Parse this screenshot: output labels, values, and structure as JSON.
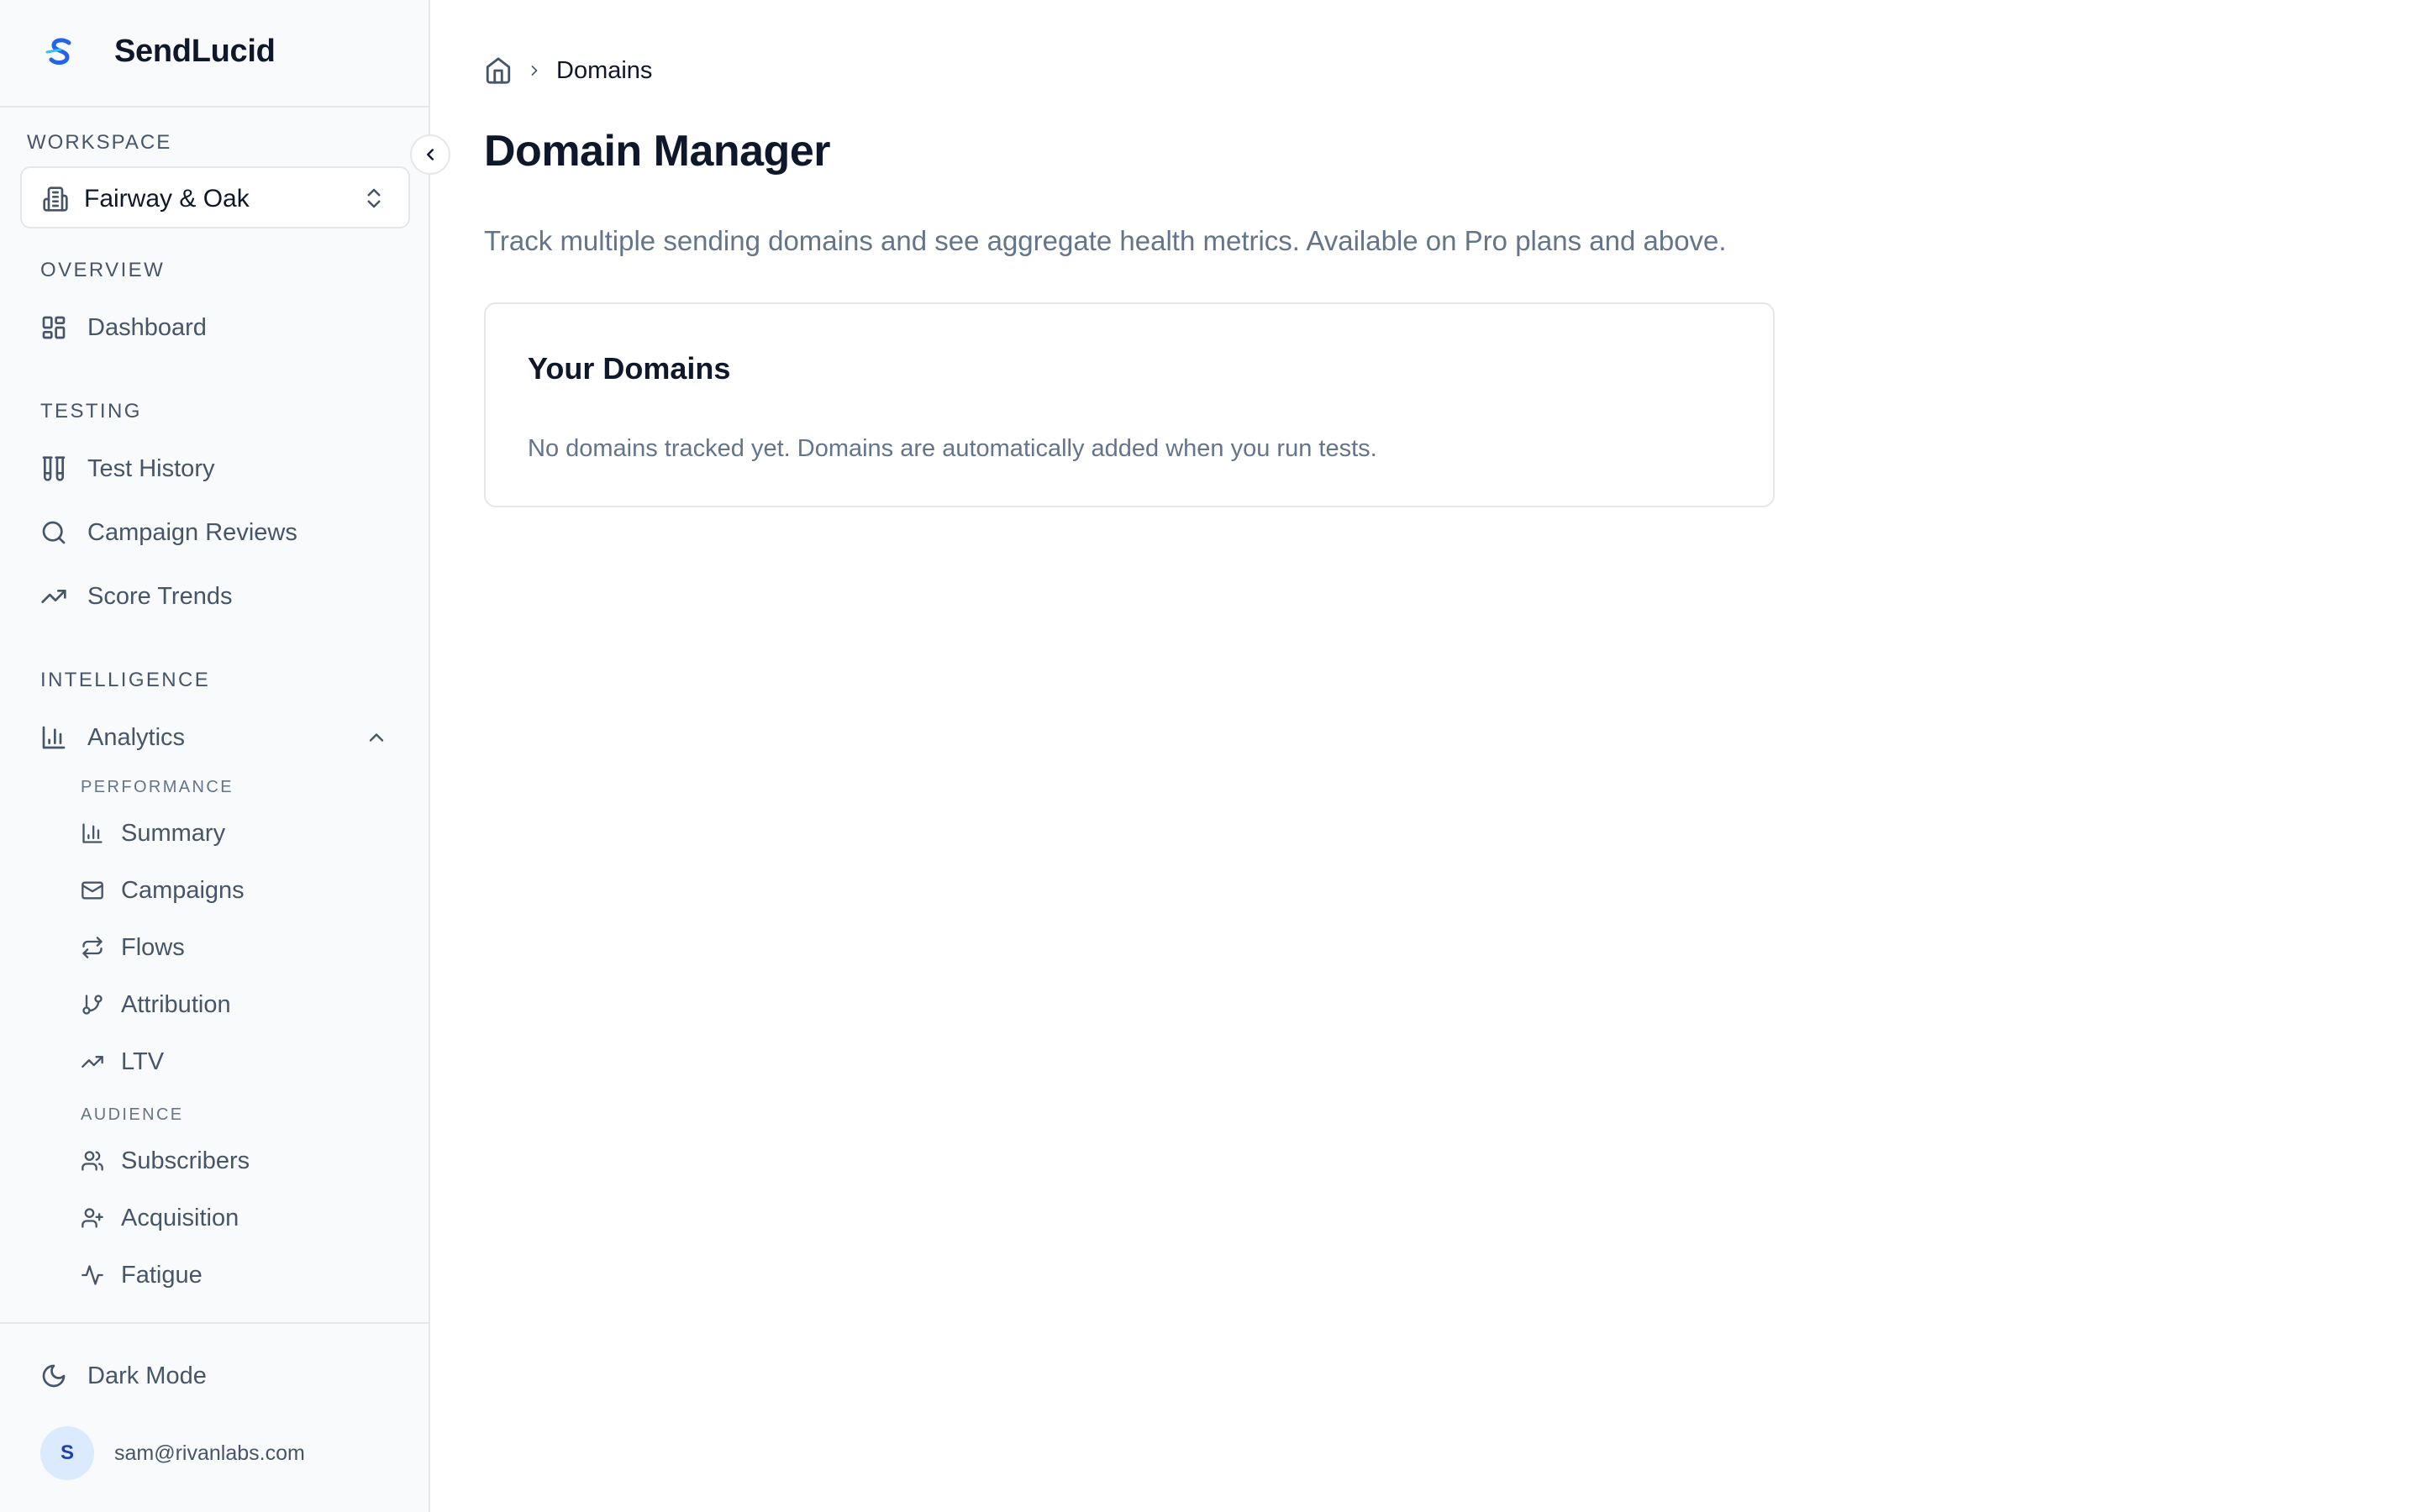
{
  "brand": {
    "name": "SendLucid"
  },
  "workspace": {
    "label": "WORKSPACE",
    "selected": "Fairway & Oak"
  },
  "nav": {
    "overview": {
      "label": "OVERVIEW",
      "items": [
        {
          "label": "Dashboard",
          "icon": "dashboard-icon"
        }
      ]
    },
    "testing": {
      "label": "TESTING",
      "items": [
        {
          "label": "Test History",
          "icon": "test-tubes-icon"
        },
        {
          "label": "Campaign Reviews",
          "icon": "search-icon"
        },
        {
          "label": "Score Trends",
          "icon": "trending-up-icon"
        }
      ]
    },
    "intelligence": {
      "label": "INTELLIGENCE",
      "analytics": {
        "label": "Analytics",
        "expanded": true,
        "groups": [
          {
            "label": "PERFORMANCE",
            "items": [
              {
                "label": "Summary",
                "icon": "bar-chart-icon"
              },
              {
                "label": "Campaigns",
                "icon": "mail-icon"
              },
              {
                "label": "Flows",
                "icon": "repeat-icon"
              },
              {
                "label": "Attribution",
                "icon": "git-branch-icon"
              },
              {
                "label": "LTV",
                "icon": "trending-up-icon"
              }
            ]
          },
          {
            "label": "AUDIENCE",
            "items": [
              {
                "label": "Subscribers",
                "icon": "users-icon"
              },
              {
                "label": "Acquisition",
                "icon": "user-plus-icon"
              },
              {
                "label": "Fatigue",
                "icon": "activity-icon"
              }
            ]
          }
        ]
      }
    }
  },
  "footer": {
    "dark_mode_label": "Dark Mode",
    "avatar_initial": "S",
    "user_email": "sam@rivanlabs.com"
  },
  "breadcrumb": {
    "current": "Domains"
  },
  "page": {
    "title": "Domain Manager",
    "description": "Track multiple sending domains and see aggregate health metrics. Available on Pro plans and above."
  },
  "card": {
    "title": "Your Domains",
    "empty_message": "No domains tracked yet. Domains are automatically added when you run tests."
  },
  "colors": {
    "accent": "#2563eb",
    "text_primary": "#0f172a",
    "text_muted": "#64748b",
    "border": "#e5e7eb",
    "sidebar_bg": "#f8fafc"
  }
}
